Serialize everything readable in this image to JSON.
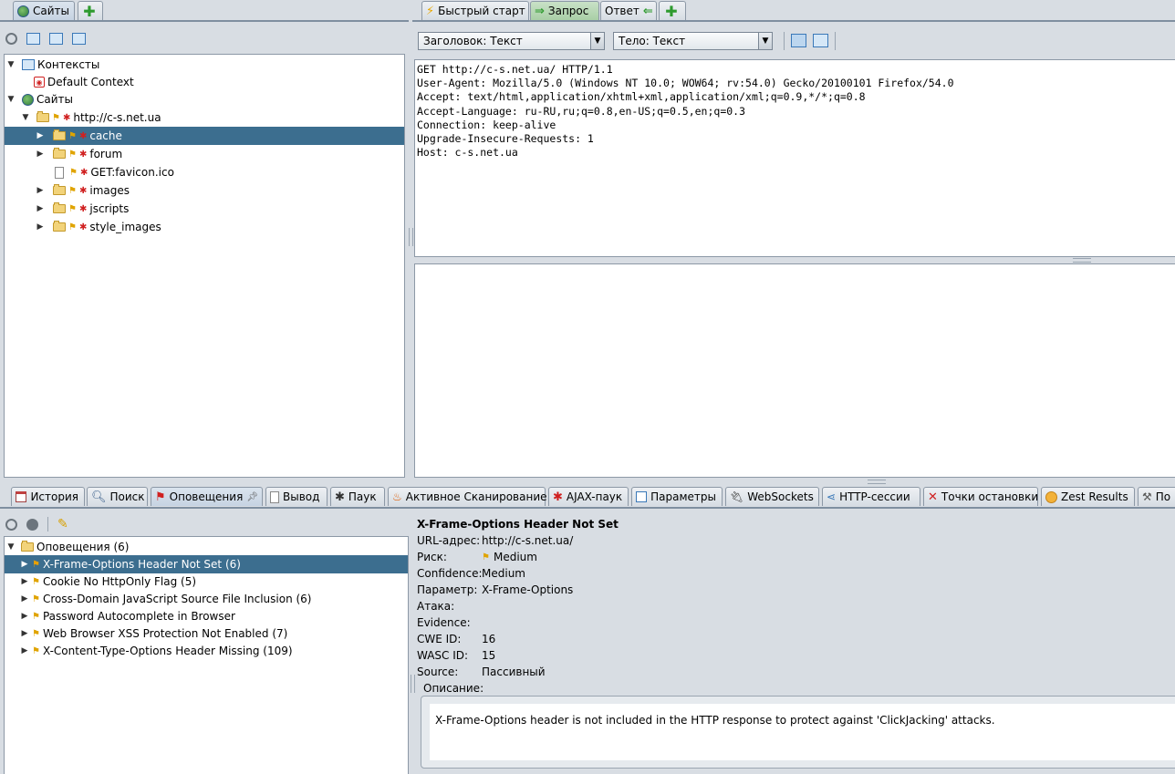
{
  "top_left_tabs": [
    {
      "label": "Сайты",
      "icon": "globe-icon"
    },
    {
      "label": "",
      "icon": "add-icon"
    }
  ],
  "top_right_tabs": [
    {
      "label": "Быстрый старт",
      "icon": "lightning-icon"
    },
    {
      "label": "Запрос",
      "icon": "arrow-right-icon"
    },
    {
      "label": "Ответ",
      "icon": "arrow-left-icon"
    },
    {
      "label": "",
      "icon": "add-icon"
    }
  ],
  "sites_tree": {
    "contexts_label": "Контексты",
    "default_context": "Default Context",
    "sites_label": "Сайты",
    "host": "http://c-s.net.ua",
    "children": [
      "cache",
      "forum",
      "GET:favicon.ico",
      "images",
      "jscripts",
      "style_images"
    ]
  },
  "request": {
    "header_select": "Заголовок: Текст",
    "body_select": "Тело: Текст",
    "lines": [
      "GET http://c-s.net.ua/ HTTP/1.1",
      "User-Agent: Mozilla/5.0 (Windows NT 10.0; WOW64; rv:54.0) Gecko/20100101 Firefox/54.0",
      "Accept: text/html,application/xhtml+xml,application/xml;q=0.9,*/*;q=0.8",
      "Accept-Language: ru-RU,ru;q=0.8,en-US;q=0.5,en;q=0.3",
      "Connection: keep-alive",
      "Upgrade-Insecure-Requests: 1",
      "Host: c-s.net.ua"
    ]
  },
  "bottom_tabs": [
    "История",
    "Поиск",
    "Оповещения",
    "Вывод",
    "Паук",
    "Активное Сканирование",
    "AJAX-паук",
    "Параметры",
    "WebSockets",
    "HTTP-сессии",
    "Точки остановки",
    "Zest Results",
    "По"
  ],
  "alerts": {
    "root": "Оповещения (6)",
    "items": [
      "X-Frame-Options Header Not Set (6)",
      "Cookie No HttpOnly Flag (5)",
      "Cross-Domain JavaScript Source File Inclusion (6)",
      "Password Autocomplete in Browser",
      "Web Browser XSS Protection Not Enabled (7)",
      "X-Content-Type-Options Header Missing (109)"
    ]
  },
  "alert_detail": {
    "title": "X-Frame-Options Header Not Set",
    "fields": [
      {
        "label": "URL-адрес:",
        "value": "http://c-s.net.ua/"
      },
      {
        "label": "Риск:",
        "value": "Medium"
      },
      {
        "label": "Confidence:",
        "value": "Medium"
      },
      {
        "label": "Параметр:",
        "value": "X-Frame-Options"
      },
      {
        "label": "Атака:",
        "value": ""
      },
      {
        "label": "Evidence:",
        "value": ""
      },
      {
        "label": "CWE ID:",
        "value": "16"
      },
      {
        "label": "WASC ID:",
        "value": "15"
      },
      {
        "label": "Source:",
        "value": "Пассивный"
      }
    ],
    "description_label": "Описание:",
    "description": "X-Frame-Options header is not included in the HTTP response to protect against 'ClickJacking' attacks."
  }
}
